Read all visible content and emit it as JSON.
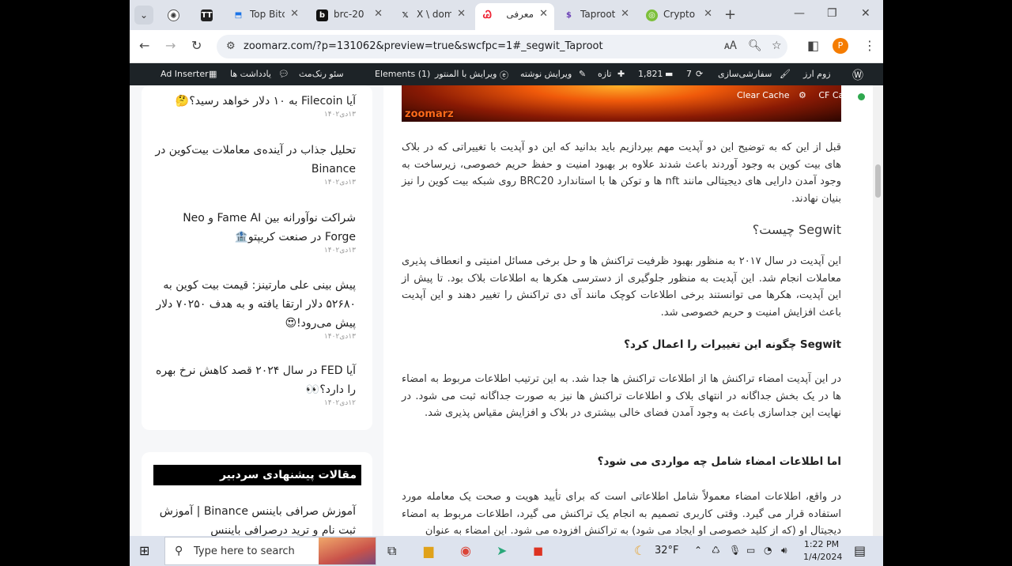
{
  "browser": {
    "tabs": [
      {
        "title": "",
        "icon": "chatgpt-icon"
      },
      {
        "title": "",
        "icon": "tt-icon"
      },
      {
        "title": "Top Bitc",
        "icon": "bookmark-icon"
      },
      {
        "title": "brc-20",
        "icon": "b-icon"
      },
      {
        "title": "X \\ dom",
        "icon": "x-icon"
      },
      {
        "title": "معرفی",
        "icon": "zoomarz-icon",
        "active": true
      },
      {
        "title": "Taproot",
        "icon": "bitcoin-s-icon"
      },
      {
        "title": "Crypto",
        "icon": "coin-icon"
      }
    ],
    "url": "zoomarz.com/?p=131062&preview=true&swcfpc=1#_segwit_Taproot",
    "profile_initial": "P"
  },
  "adminbar": {
    "ad_inserter": "Ad Inserter",
    "notes": "یادداشت ها",
    "seo": "سئو رنک‌مث",
    "elements": "Elements (1)",
    "edit_with": "ویرایش با المنتور",
    "edit_post": "ویرایش نوشته",
    "new": "تازه",
    "comments": "1,821",
    "updates": "7",
    "customize": "سفارشی‌سازی",
    "site": "زوم ارز",
    "clear_cache": "Clear Cache",
    "cf": "CF Cac"
  },
  "sidebar": {
    "items": [
      {
        "title": "آیا Filecoin به ۱۰ دلار خواهد رسید؟🤔",
        "date": "۱۳دی۱۴۰۲"
      },
      {
        "title": "تحلیل جذاب در آینده‌ی معاملات بیت‌کوین در Binance",
        "date": "۱۳دی۱۴۰۲"
      },
      {
        "title": "شراکت نوآورانه بین Fame AI و Neo Forge در صنعت کریپتو🏦",
        "date": "۱۳دی۱۴۰۲"
      },
      {
        "title": "پیش بینی علی مارتینز: قیمت بیت کوین به ۵۲۶۸۰ دلار ارتقا یافته و به هدف ۷۰۲۵۰ دلار پیش می‌رود!😍",
        "date": "۱۳دی۱۴۰۲"
      },
      {
        "title": "آیا FED در سال ۲۰۲۴ قصد کاهش نرخ بهره را دارد؟👀",
        "date": "۱۲دی۱۴۰۲"
      }
    ],
    "editors_heading": "مقالات پیشنهادی سردبیر",
    "editors_first": "آموزش صرافی بایننس Binance | آموزش ثبت نام و ترید درصرافی بایننس"
  },
  "article": {
    "hero_brand": "zoomarz",
    "p1": "قبل از این که به توضیح این دو آپدیت مهم بپردازیم باید بدانید که این دو آپدیت با تغییراتی که در بلاک های بیت کوین به وجود آوردند باعث شدند علاوه بر بهبود امنیت و حفظ حریم خصوصی، زیرساخت به وجود آمدن دارایی های دیجیتالی مانند nft ها و توکن ها با استاندارد BRC20 روی شبکه بیت کوین را نیز بنیان نهادند.",
    "h2": "Segwit چیست؟",
    "p2": "این آپدیت در سال ۲۰۱۷ به منظور بهبود ظرفیت تراکنش ها و حل برخی مسائل امنیتی و انعطاف پذیری معاملات انجام شد. این آپدیت به منظور جلوگیری از دسترسی هکرها به اطلاعات بلاک بود. تا پیش از این آپدیت، هکرها می توانستند برخی اطلاعات کوچک مانند آی دی تراکنش را تغییر دهند و این آپدیت باعث افزایش امنیت و حریم خصوصی شد.",
    "h3a": "Segwit چگونه این تغییرات را اعمال کرد؟",
    "p3": "در این آپدیت امضاء تراکنش ها از اطلاعات تراکنش ها جدا شد. به این ترتیب اطلاعات مربوط به امضاء ها در یک بخش جداگانه در انتهای بلاک و اطلاعات تراکنش ها نیز به صورت جداگانه ثبت می شود. در نهایت این جداسازی باعث به وجود آمدن فضای خالی بیشتری در بلاک و افزایش مقیاس پذیری شد.",
    "h3b": "اما اطلاعات امضاء شامل چه مواردی می شود؟",
    "p4": "در واقع، اطلاعات امضاء معمولاً شامل اطلاعاتی است که برای تأیید هویت و صحت یک معامله مورد استفاده قرار می گیرد. وقتی کاربری تصمیم به انجام یک تراکنش می گیرد، اطلاعات مربوط به امضاء دیجیتال او (که از کلید خصوصی او ایجاد می شود) به تراکنش افزوده می شود. این امضاء به عنوان"
  },
  "taskbar": {
    "search_placeholder": "Type here to search",
    "weather": "32°F",
    "time": "1:22 PM",
    "date": "1/4/2024"
  }
}
